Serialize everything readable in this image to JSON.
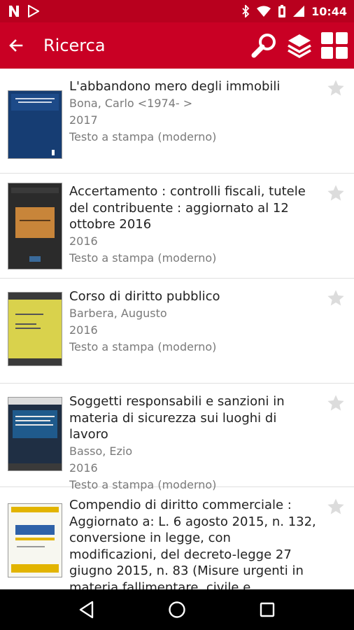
{
  "status_bar": {
    "time": "10:44",
    "left_icons": [
      "netflix-n-icon",
      "play-store-icon"
    ],
    "right_icons": [
      "bluetooth-icon",
      "wifi-icon",
      "battery-icon",
      "signal-icon"
    ]
  },
  "app_bar": {
    "title": "Ricerca",
    "back_icon": "arrow-left-icon",
    "actions": [
      "search-icon",
      "layers-icon",
      "grid-icon"
    ]
  },
  "results": [
    {
      "title": "L'abbandono mero degli immobili",
      "author": "Bona, Carlo <1974-     >",
      "year": "2017",
      "type": "Testo a stampa (moderno)"
    },
    {
      "title": "Accertamento : controlli fiscali, tutele del contribuente : aggiornato al 12 ottobre 2016",
      "author": "",
      "year": "2016",
      "type": "Testo a stampa (moderno)"
    },
    {
      "title": "Corso di diritto pubblico",
      "author": "Barbera, Augusto",
      "year": "2016",
      "type": "Testo a stampa (moderno)"
    },
    {
      "title": "Soggetti responsabili e sanzioni in materia di sicurezza sui luoghi di lavoro",
      "author": "Basso, Ezio",
      "year": "2016",
      "type": "Testo a stampa (moderno)"
    },
    {
      "title": "Compendio di diritto commerciale : Aggiornato a: L. 6 agosto 2015, n. 132, conversione in legge, con modificazioni, del decreto-legge 27 giugno 2015, n. 83 (Misure urgenti in materia fallimentare, civile e processuale civile",
      "author": "",
      "year": "",
      "type": ""
    }
  ],
  "nav_bar": {
    "buttons": [
      "back-triangle-icon",
      "home-circle-icon",
      "recents-square-icon"
    ]
  },
  "colors": {
    "status_bar": "#b8001e",
    "app_bar": "#c90024",
    "secondary_text": "#7a7a7a",
    "star": "#dcdcdc"
  }
}
